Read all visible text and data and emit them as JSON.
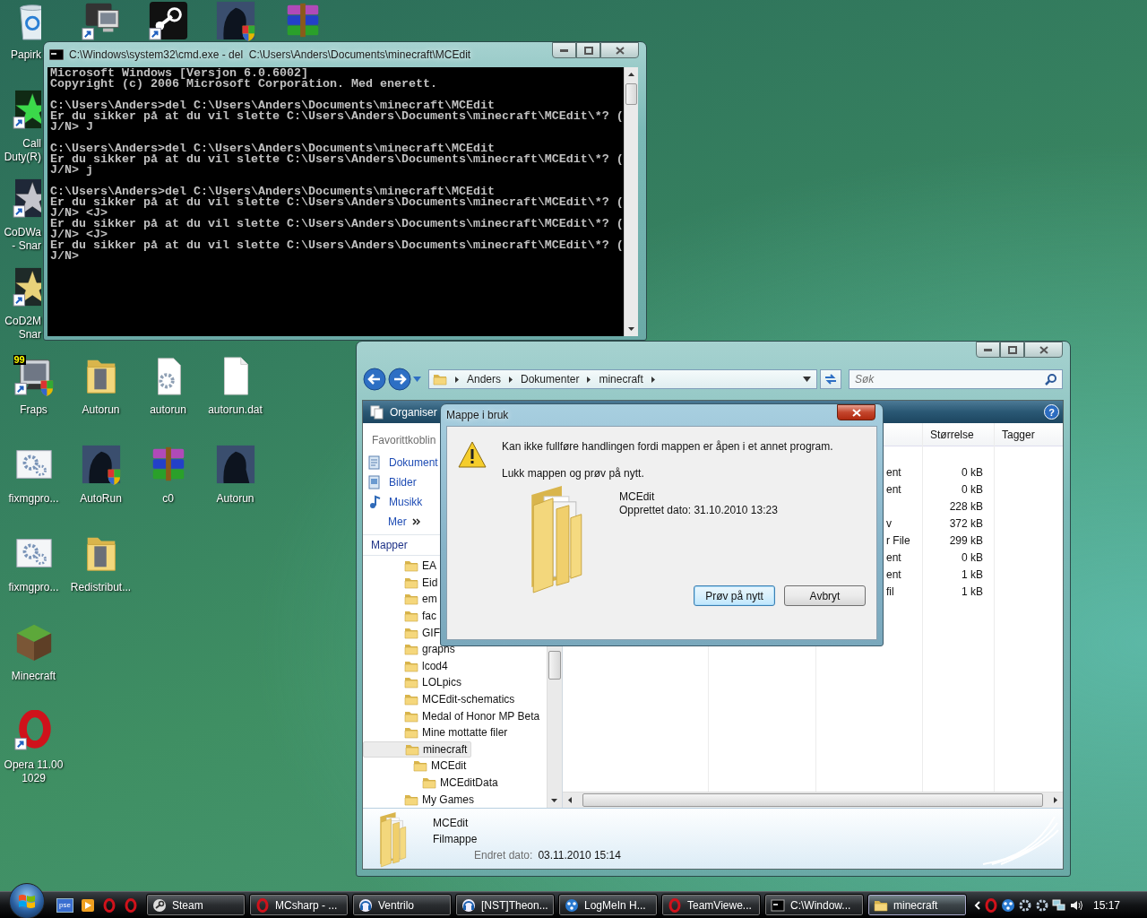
{
  "desktop": {
    "icon_rows": [
      [
        {
          "kind": "recycle-bin",
          "label": "Papirk",
          "covered": true,
          "shortcut": false,
          "shield": false
        },
        {
          "kind": "monitor",
          "covered": false,
          "shortcut": true,
          "shield": false
        },
        {
          "kind": "steam",
          "covered": false,
          "shortcut": true,
          "shield": false
        },
        {
          "kind": "soldier",
          "covered": false,
          "shortcut": false,
          "shield": true
        },
        {
          "kind": "archive",
          "covered": false,
          "shortcut": false,
          "shield": false
        }
      ],
      [
        {
          "kind": "green-star",
          "label": "Call\nDuty(R)",
          "covered": true,
          "shortcut": true,
          "shield": false
        }
      ],
      [
        {
          "kind": "silver-star",
          "label": "CoDWa\n- Snar",
          "covered": true,
          "shortcut": true,
          "shield": false
        }
      ],
      [
        {
          "kind": "gold-star",
          "label": "CoD2M\nSnar",
          "covered": true,
          "shortcut": true,
          "shield": false
        }
      ],
      [
        {
          "kind": "fraps",
          "badge": "99",
          "label": "Fraps",
          "covered": false,
          "shortcut": true,
          "shield": true
        },
        {
          "kind": "folder",
          "label": "Autorun",
          "covered": false,
          "shortcut": false,
          "shield": false
        },
        {
          "kind": "gear-file",
          "label": "autorun",
          "covered": false,
          "shortcut": false,
          "shield": false
        },
        {
          "kind": "blank-file",
          "label": "autorun.dat",
          "covered": false,
          "shortcut": false,
          "shield": false
        }
      ],
      [
        {
          "kind": "gear-window",
          "label": "fixmgpro...",
          "covered": false,
          "shortcut": false,
          "shield": false
        },
        {
          "kind": "soldier",
          "label": "AutoRun",
          "covered": false,
          "shortcut": false,
          "shield": true
        },
        {
          "kind": "archive",
          "label": "c0",
          "covered": false,
          "shortcut": false,
          "shield": false
        },
        {
          "kind": "soldier",
          "label": "Autorun",
          "covered": false,
          "shortcut": false,
          "shield": false
        }
      ],
      [
        {
          "kind": "gear-window",
          "label": "fixmgpro...",
          "covered": false,
          "shortcut": false,
          "shield": false
        },
        {
          "kind": "folder",
          "label": "Redistribut...",
          "covered": false,
          "shortcut": false,
          "shield": false
        }
      ],
      [
        {
          "kind": "grass-block",
          "label": "Minecraft",
          "covered": false,
          "shortcut": false,
          "shield": false
        }
      ],
      [
        {
          "kind": "opera",
          "label": "Opera 11.00\n1029",
          "covered": false,
          "shortcut": true,
          "shield": false
        }
      ]
    ]
  },
  "console_window": {
    "title": "C:\\Windows\\system32\\cmd.exe - del  C:\\Users\\Anders\\Documents\\minecraft\\MCEdit",
    "blocks": [
      [
        "Microsoft Windows [Versjon 6.0.6002]",
        "Copyright (c) 2006 Microsoft Corporation. Med enerett."
      ],
      [
        "C:\\Users\\Anders>del C:\\Users\\Anders\\Documents\\minecraft\\MCEdit",
        "Er du sikker på at du vil slette C:\\Users\\Anders\\Documents\\minecraft\\MCEdit\\*? (",
        "J/N> J"
      ],
      [
        "C:\\Users\\Anders>del C:\\Users\\Anders\\Documents\\minecraft\\MCEdit",
        "Er du sikker på at du vil slette C:\\Users\\Anders\\Documents\\minecraft\\MCEdit\\*? (",
        "J/N> j"
      ],
      [
        "C:\\Users\\Anders>del C:\\Users\\Anders\\Documents\\minecraft\\MCEdit",
        "Er du sikker på at du vil slette C:\\Users\\Anders\\Documents\\minecraft\\MCEdit\\*? (",
        "J/N> <J>",
        "Er du sikker på at du vil slette C:\\Users\\Anders\\Documents\\minecraft\\MCEdit\\*? (",
        "J/N> <J>",
        "Er du sikker på at du vil slette C:\\Users\\Anders\\Documents\\minecraft\\MCEdit\\*? (",
        "J/N>"
      ]
    ]
  },
  "explorer": {
    "breadcrumb": [
      "Anders",
      "Dokumenter",
      "minecraft"
    ],
    "search": {
      "placeholder": "Søk"
    },
    "toolbar": {
      "organize": "Organiser",
      "help": "?"
    },
    "favorites": {
      "title": "Favorittkoblin",
      "links": [
        {
          "kind": "documents",
          "label": "Dokument"
        },
        {
          "kind": "pictures",
          "label": "Bilder"
        },
        {
          "kind": "music",
          "label": "Musikk"
        }
      ],
      "more": "Mer"
    },
    "folders_title": "Mapper",
    "tree": [
      {
        "label": "EA",
        "selected": false
      },
      {
        "label": "Eid",
        "selected": false
      },
      {
        "label": "em",
        "selected": false
      },
      {
        "label": "fac",
        "selected": false
      },
      {
        "label": "GIF",
        "selected": false
      },
      {
        "label": "graphs",
        "selected": false
      },
      {
        "label": "lcod4",
        "selected": false
      },
      {
        "label": "LOLpics",
        "selected": false
      },
      {
        "label": "MCEdit-schematics",
        "selected": false
      },
      {
        "label": "Medal of Honor MP Beta",
        "selected": false
      },
      {
        "label": "Mine mottatte filer",
        "selected": false
      },
      {
        "label": "minecraft",
        "selected": true,
        "children": [
          {
            "label": "MCEdit",
            "selected": false,
            "children": [
              {
                "label": "MCEditData",
                "selected": false
              }
            ]
          }
        ]
      },
      {
        "label": "My Games",
        "selected": false
      }
    ],
    "column_headers": [
      "Størrelse",
      "Tagger"
    ],
    "rows": [
      {
        "column_3": "ent",
        "size": "0 kB"
      },
      {
        "column_3": "ent",
        "size": "0 kB"
      },
      {
        "size": "228 kB"
      },
      {
        "column_3": "v",
        "size": "372 kB"
      },
      {
        "column_3": "r File",
        "size": "299 kB"
      },
      {
        "column_3": "ent",
        "size": "0 kB"
      },
      {
        "column_3": "ent",
        "size": "1 kB"
      },
      {
        "column_3": "fil",
        "size": "1 kB"
      }
    ],
    "details": {
      "name": "MCEdit",
      "type": "Filmappe",
      "date_label": "Endret dato:",
      "date": "03.11.2010 15:14"
    }
  },
  "dialog": {
    "title": "Mappe i bruk",
    "message": "Kan ikke fullføre handlingen fordi mappen er åpen i et annet program.",
    "instruction": "Lukk mappen og prøv på nytt.",
    "item": {
      "name": "MCEdit",
      "created": "Opprettet dato: 31.10.2010 13:23"
    },
    "buttons": [
      {
        "label": "Prøv på nytt",
        "default": true
      },
      {
        "label": "Avbryt",
        "default": false
      }
    ]
  },
  "taskbar": {
    "quick_launch": [
      {
        "kind": "text-tile",
        "text": "pse"
      },
      {
        "kind": "media"
      },
      {
        "kind": "opera"
      },
      {
        "kind": "opera"
      }
    ],
    "tasks": [
      {
        "kind": "steam",
        "label": "Steam",
        "selected": false
      },
      {
        "kind": "opera",
        "label": "MCsharp - ...",
        "selected": false
      },
      {
        "kind": "ventrilo",
        "label": "Ventrilo",
        "selected": false
      },
      {
        "kind": "ventrilo",
        "label": "[NST]Theon...",
        "selected": false
      },
      {
        "kind": "logmein",
        "label": "LogMeIn H...",
        "selected": false
      },
      {
        "kind": "opera",
        "label": "TeamViewe...",
        "selected": false
      },
      {
        "kind": "cmd",
        "label": "C:\\Window...",
        "selected": false
      },
      {
        "kind": "folder",
        "label": "minecraft",
        "selected": true
      }
    ],
    "tray": [
      {
        "kind": "opera"
      },
      {
        "kind": "logmein"
      },
      {
        "kind": "gear"
      },
      {
        "kind": "gear"
      },
      {
        "kind": "network"
      },
      {
        "kind": "volume"
      }
    ],
    "clock": "15:17"
  }
}
